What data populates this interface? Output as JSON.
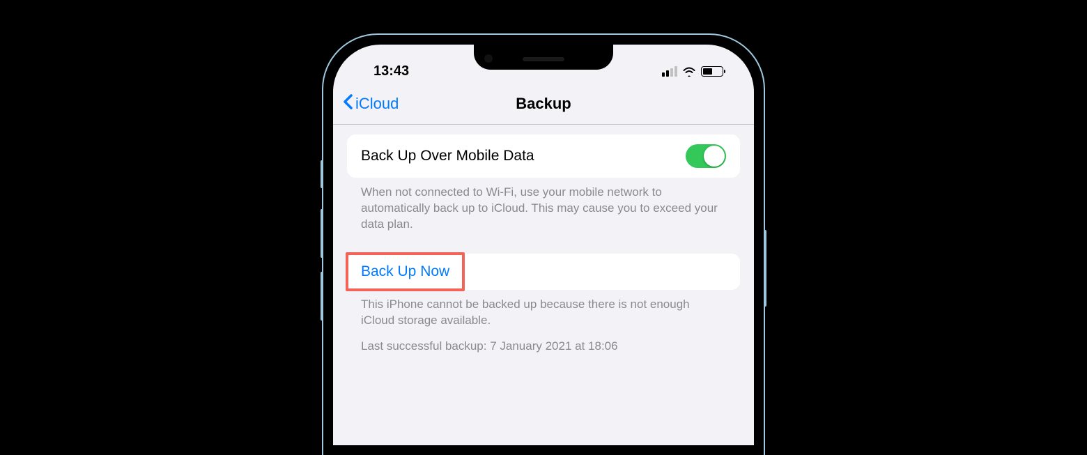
{
  "status_bar": {
    "time": "13:43"
  },
  "nav": {
    "back_label": "iCloud",
    "title": "Backup"
  },
  "mobile_data_cell": {
    "label": "Back Up Over Mobile Data",
    "toggle_on": true,
    "footer": "When not connected to Wi-Fi, use your mobile network to automatically back up to iCloud. This may cause you to exceed your data plan."
  },
  "backup_action": {
    "label": "Back Up Now",
    "error": "This iPhone cannot be backed up because there is not enough iCloud storage available.",
    "last_backup": "Last successful backup: 7 January 2021 at 18:06"
  },
  "colors": {
    "ios_blue": "#007aff",
    "toggle_green": "#34c759",
    "highlight_red": "#f26457",
    "settings_bg": "#f2f2f7"
  }
}
